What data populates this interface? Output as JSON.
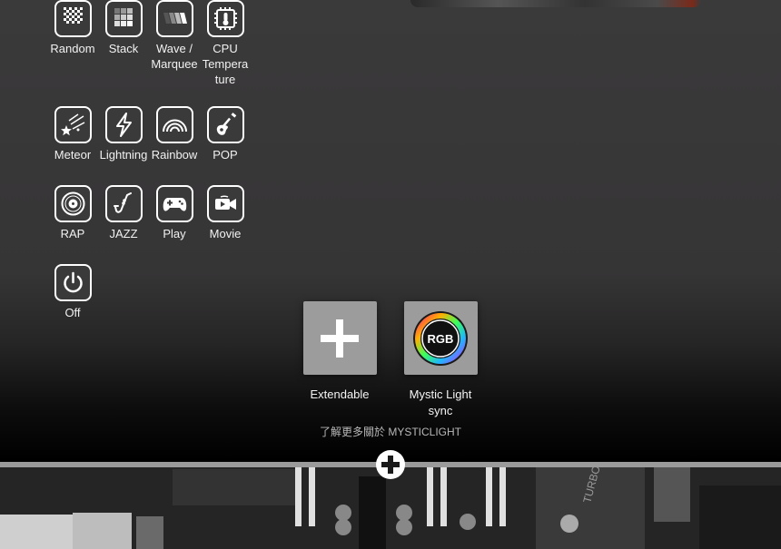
{
  "effects": [
    {
      "label": "Random"
    },
    {
      "label": "Stack"
    },
    {
      "label": "Wave / Marquee"
    },
    {
      "label": "CPU Temperature"
    },
    {
      "label": "Meteor"
    },
    {
      "label": "Lightning"
    },
    {
      "label": "Rainbow"
    },
    {
      "label": "POP"
    },
    {
      "label": "RAP"
    },
    {
      "label": "JAZZ"
    },
    {
      "label": "Play"
    },
    {
      "label": "Movie"
    },
    {
      "label": "Off"
    }
  ],
  "cpu_label_lines": [
    "CPU",
    "Tempera",
    "ture"
  ],
  "wave_label_lines": [
    "Wave /",
    "Marquee"
  ],
  "features": {
    "extendable": "Extendable",
    "mystic_line1": "Mystic Light",
    "mystic_line2": "sync",
    "rgb_badge": "RGB"
  },
  "more_link": "了解更多關於 MYSTICLIGHT",
  "icons": [
    "random-icon",
    "stack-icon",
    "wave-icon",
    "cpu-temperature-icon",
    "meteor-icon",
    "lightning-icon",
    "rainbow-icon",
    "guitar-icon",
    "vinyl-record-icon",
    "saxophone-icon",
    "gamepad-icon",
    "video-camera-icon",
    "power-icon",
    "plus-icon",
    "rgb-ring-icon"
  ],
  "board_text": "TURBO"
}
